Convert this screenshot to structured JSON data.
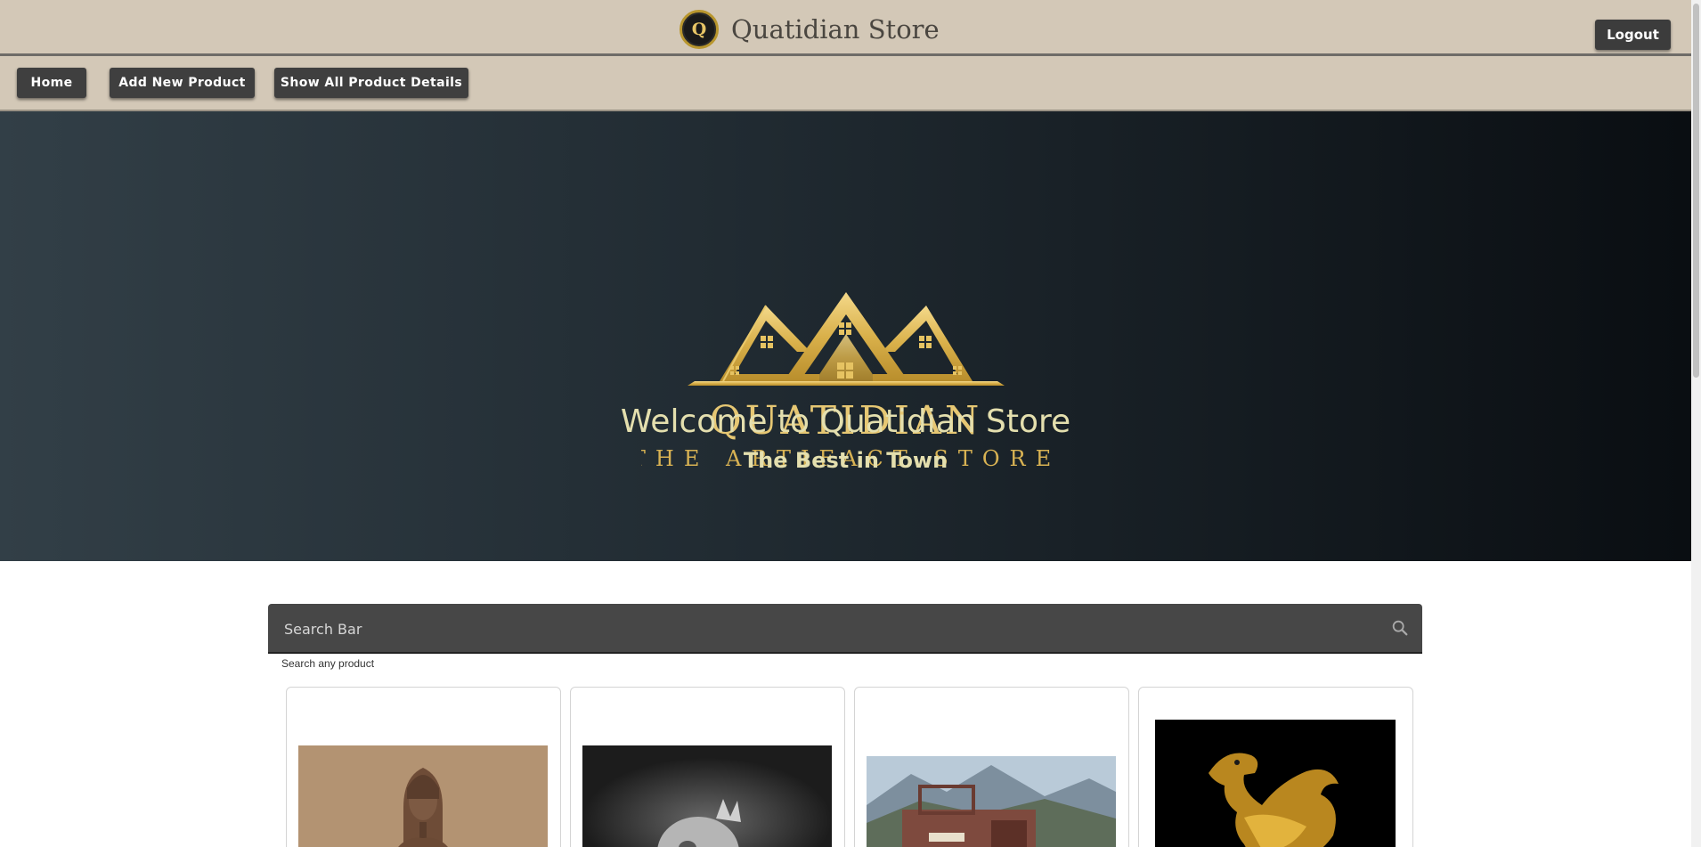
{
  "header": {
    "brand_logo_letter": "Q",
    "brand_title": "Quatidian Store",
    "logout_label": "Logout"
  },
  "nav": {
    "items": [
      {
        "label": "Home"
      },
      {
        "label": "Add New Product"
      },
      {
        "label": "Show All Product Details"
      }
    ]
  },
  "hero": {
    "logo_wordmark": "QUATIDIAN",
    "logo_tagline": "THE ARTIFACT STORE",
    "title": "Welcome to Quatidian Store",
    "subtitle": "The Best in Town"
  },
  "search": {
    "placeholder": "Search Bar",
    "helper": "Search any product",
    "icon": "search-icon"
  },
  "products": [
    {
      "image": "pharaoh-statue-image"
    },
    {
      "image": "stone-skull-bw-image"
    },
    {
      "image": "vintage-truck-image"
    },
    {
      "image": "golden-griffin-ewer-image"
    }
  ],
  "colors": {
    "header_bg": "#d3c8b7",
    "button_bg": "#3f3f3f",
    "hero_gradient_start": "#323f47",
    "hero_gradient_end": "#0a0e12",
    "hero_text": "#e4dfae",
    "gold": "#e2bd5b",
    "search_bg": "#474747"
  }
}
